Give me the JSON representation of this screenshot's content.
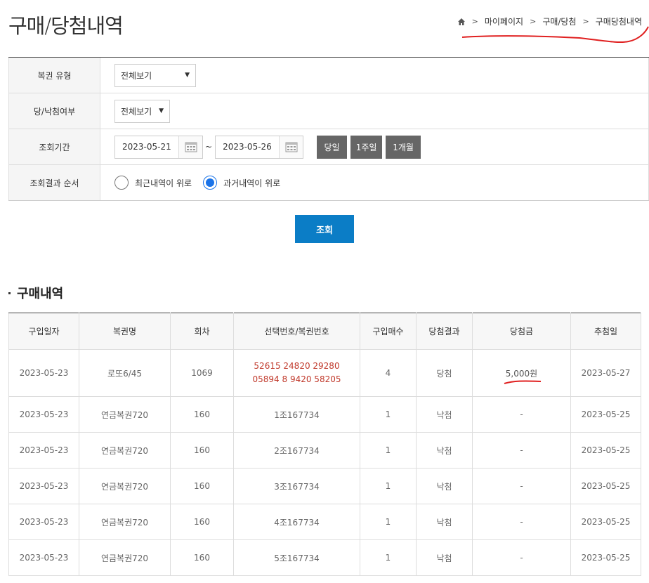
{
  "header": {
    "title": "구매/당첨내역",
    "breadcrumb": [
      "마이페이지",
      "구매/당첨",
      "구매당첨내역"
    ]
  },
  "filter": {
    "type_label": "복권 유형",
    "type_value": "전체보기",
    "win_label": "당/낙첨여부",
    "win_value": "전체보기",
    "period_label": "조회기간",
    "date_from": "2023-05-21",
    "date_to": "2023-05-26",
    "tilde": "~",
    "quick": [
      "당일",
      "1주일",
      "1개월"
    ],
    "order_label": "조회결과 순서",
    "order_options": [
      "최근내역이 위로",
      "과거내역이 위로"
    ],
    "order_selected": 1,
    "search_label": "조회"
  },
  "section": {
    "title": "구매내역"
  },
  "table": {
    "headers": [
      "구입일자",
      "복권명",
      "회차",
      "선택번호/복권번호",
      "구입매수",
      "당첨결과",
      "당첨금",
      "추첨일"
    ],
    "rows": [
      [
        "2023-05-23",
        "로또6/45",
        "1069",
        "52615 24820 29280 05894 8 9420 58205",
        "4",
        "당첨",
        "5,000원",
        "2023-05-27"
      ],
      [
        "2023-05-23",
        "연금복권720",
        "160",
        "1조167734",
        "1",
        "낙첨",
        "-",
        "2023-05-25"
      ],
      [
        "2023-05-23",
        "연금복권720",
        "160",
        "2조167734",
        "1",
        "낙첨",
        "-",
        "2023-05-25"
      ],
      [
        "2023-05-23",
        "연금복권720",
        "160",
        "3조167734",
        "1",
        "낙첨",
        "-",
        "2023-05-25"
      ],
      [
        "2023-05-23",
        "연금복권720",
        "160",
        "4조167734",
        "1",
        "낙첨",
        "-",
        "2023-05-25"
      ],
      [
        "2023-05-23",
        "연금복권720",
        "160",
        "5조167734",
        "1",
        "낙첨",
        "-",
        "2023-05-25"
      ]
    ]
  },
  "colors": {
    "accent": "#0b7dc6",
    "radio": "#1a73e8",
    "numbers": "#c0392b",
    "annotation": "#e02020"
  }
}
